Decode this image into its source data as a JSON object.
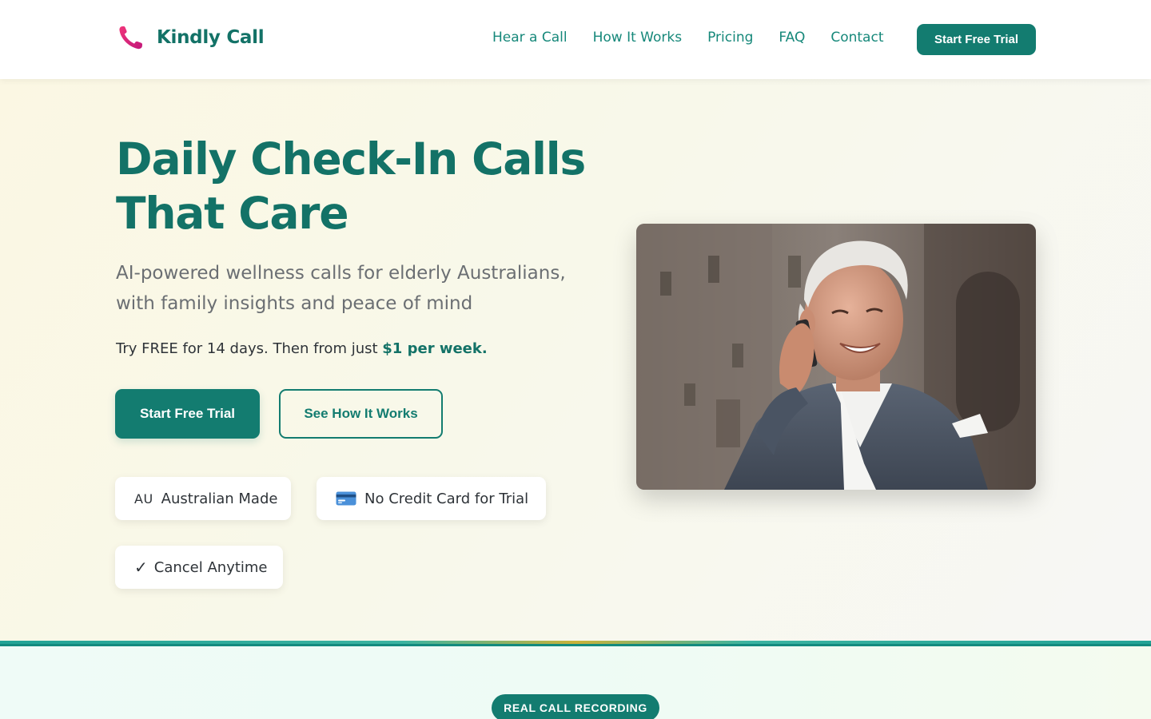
{
  "header": {
    "brand_name": "Kindly Call",
    "brand_icon": "phone-icon",
    "nav": [
      {
        "label": "Hear a Call"
      },
      {
        "label": "How It Works"
      },
      {
        "label": "Pricing"
      },
      {
        "label": "FAQ"
      },
      {
        "label": "Contact"
      }
    ],
    "cta_label": "Start Free Trial"
  },
  "hero": {
    "title_line1": "Daily Check-In Calls",
    "title_line2": "That Care",
    "subtitle": "AI-powered wellness calls for elderly Australians, with family insights and peace of mind",
    "offer_prefix": "Try FREE for 14 days. Then from just",
    "offer_price": "$1 per week.",
    "primary_button": "Start Free Trial",
    "secondary_button": "See How It Works",
    "badges": [
      {
        "icon": "AU",
        "label": "Australian Made"
      },
      {
        "icon": "credit-card-icon",
        "label": "No Credit Card for Trial"
      },
      {
        "icon": "✓",
        "label": "Cancel Anytime"
      }
    ],
    "photo_icon": "senior-man-on-phone-photo"
  },
  "next_section": {
    "tag": "REAL CALL RECORDING"
  },
  "colors": {
    "brand": "#137267",
    "accent": "#137c70",
    "logo_gradient_start": "#f0357a",
    "logo_gradient_end": "#c2187a"
  }
}
